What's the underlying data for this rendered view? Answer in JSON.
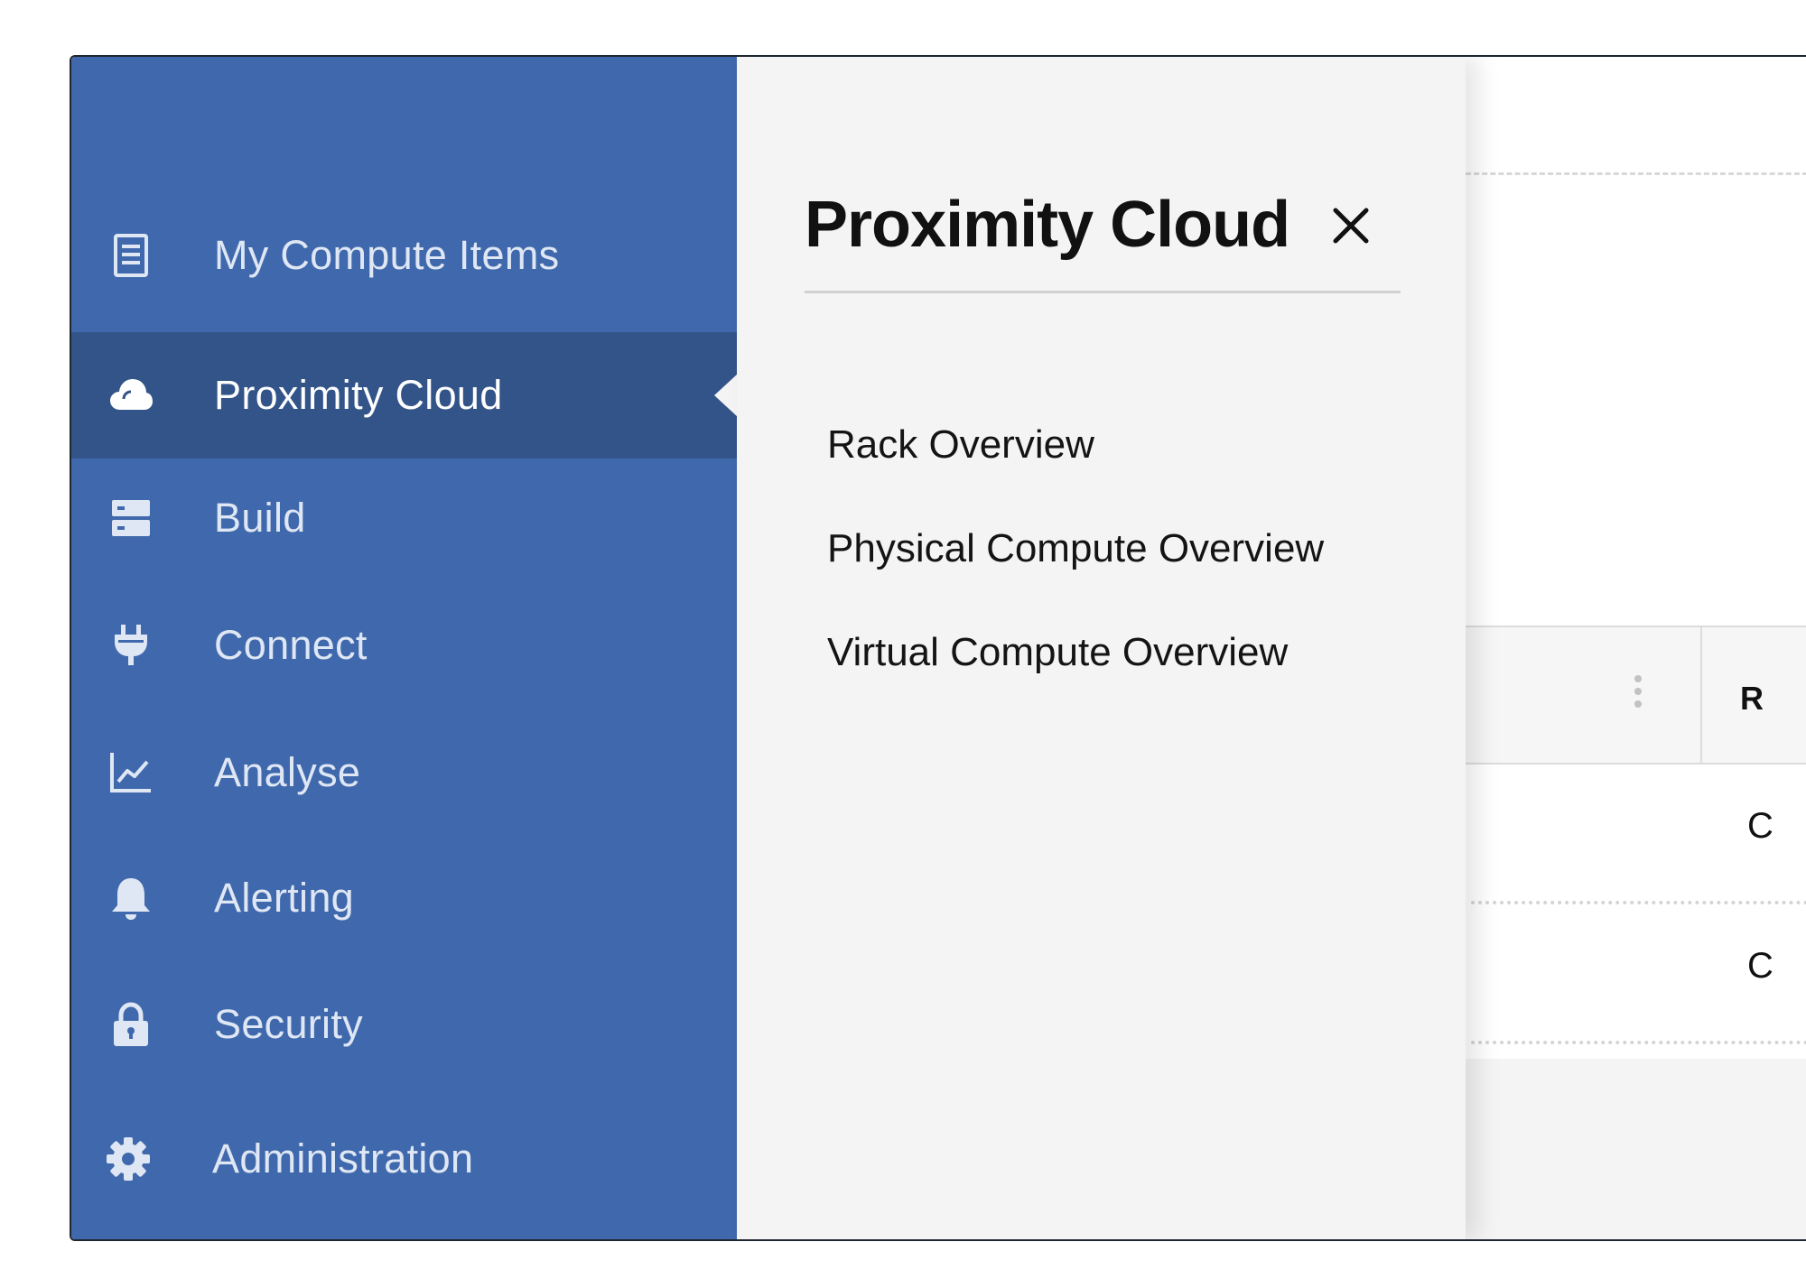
{
  "sidebar": {
    "items": [
      {
        "label": "My Compute Items",
        "icon": "document-list-icon"
      },
      {
        "label": "Proximity Cloud",
        "icon": "cloud-icon",
        "active": true
      },
      {
        "label": "Build",
        "icon": "server-icon"
      },
      {
        "label": "Connect",
        "icon": "plug-icon"
      },
      {
        "label": "Analyse",
        "icon": "line-chart-icon"
      },
      {
        "label": "Alerting",
        "icon": "bell-icon"
      },
      {
        "label": "Security",
        "icon": "lock-icon"
      },
      {
        "label": "Administration",
        "icon": "gear-icon"
      }
    ]
  },
  "flyout": {
    "title": "Proximity Cloud",
    "close_icon": "close-icon",
    "items": [
      {
        "label": "Rack Overview"
      },
      {
        "label": "Physical Compute Overview"
      },
      {
        "label": "Virtual Compute Overview"
      }
    ]
  },
  "background_table": {
    "column_header_partial": "R",
    "cells_partial": [
      "C",
      "C"
    ]
  },
  "colors": {
    "sidebar_bg": "#4069ad",
    "sidebar_active_bg": "#325489",
    "flyout_bg": "#f4f4f4"
  }
}
